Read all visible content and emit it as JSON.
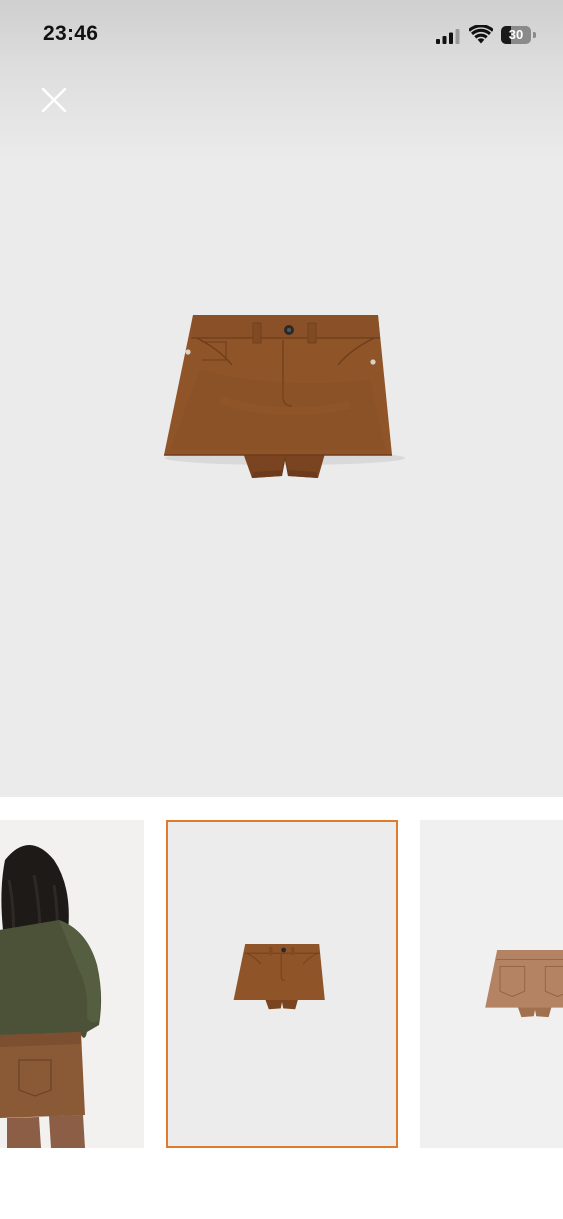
{
  "status_bar": {
    "time": "23:46",
    "battery_level": "30",
    "icons": [
      "cellular-signal-icon",
      "wifi-icon",
      "battery-icon"
    ]
  },
  "viewer": {
    "close_icon": "close-icon",
    "main_image": "brown-suede-mini-skort-front",
    "background_color": "#ebebeb"
  },
  "thumbnails": [
    {
      "image": "model-back-view-skort",
      "selected": false
    },
    {
      "image": "brown-suede-mini-skort-front",
      "selected": true
    },
    {
      "image": "brown-suede-mini-skort-back",
      "selected": false
    }
  ],
  "colors": {
    "selected_border": "#e07b2e",
    "skirt_brown": "#8f5428"
  }
}
